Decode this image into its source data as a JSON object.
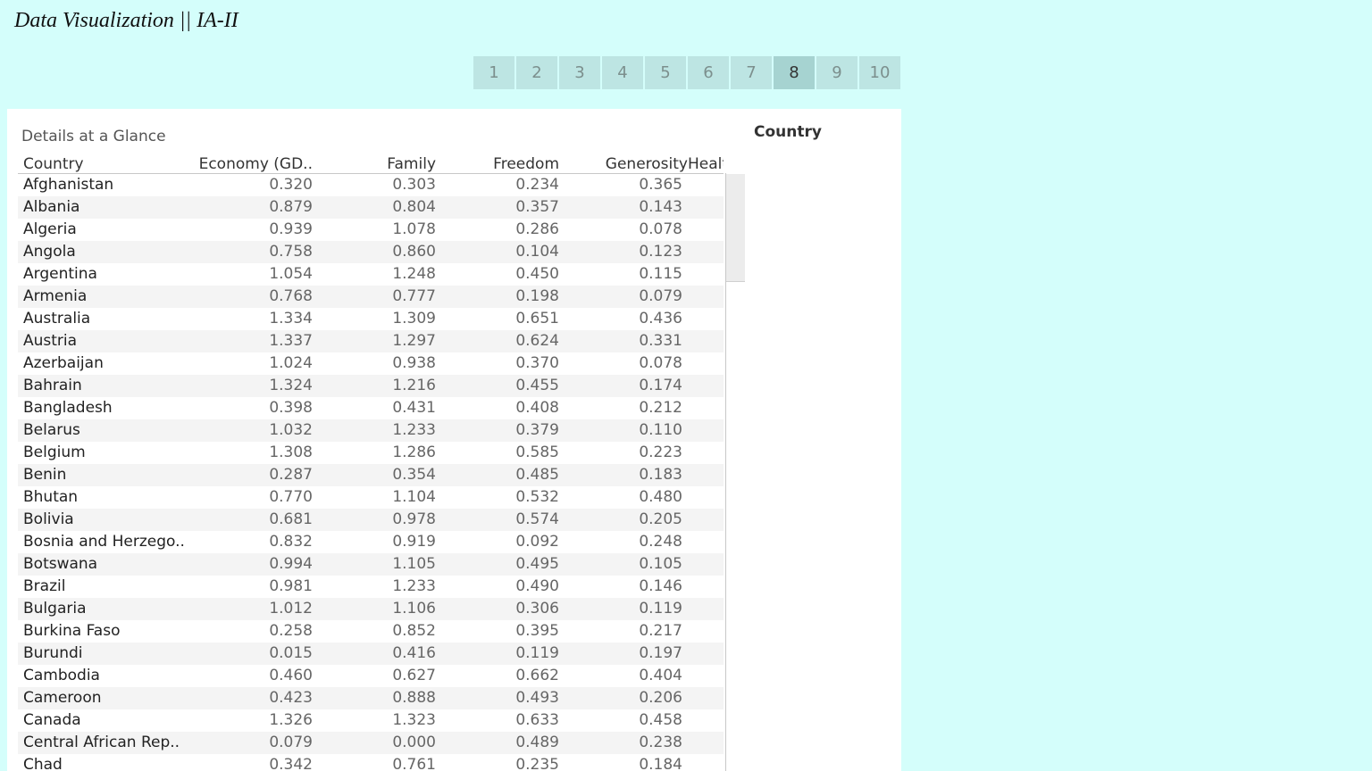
{
  "app": {
    "title": "Data Visualization || IA-II"
  },
  "tabs": [
    {
      "label": "1",
      "active": false
    },
    {
      "label": "2",
      "active": false
    },
    {
      "label": "3",
      "active": false
    },
    {
      "label": "4",
      "active": false
    },
    {
      "label": "5",
      "active": false
    },
    {
      "label": "6",
      "active": false
    },
    {
      "label": "7",
      "active": false
    },
    {
      "label": "8",
      "active": true
    },
    {
      "label": "9",
      "active": false
    },
    {
      "label": "10",
      "active": false
    }
  ],
  "sheet": {
    "title": "Details at a Glance"
  },
  "filter": {
    "title": "Country"
  },
  "table": {
    "headers": {
      "country": "Country",
      "economy": "Economy (GD..",
      "family": "Family",
      "freedom": "Freedom",
      "generosity": "Generosity",
      "health": "Healt"
    },
    "rows": [
      [
        "Afghanistan",
        "0.320",
        "0.303",
        "0.234",
        "0.365"
      ],
      [
        "Albania",
        "0.879",
        "0.804",
        "0.357",
        "0.143"
      ],
      [
        "Algeria",
        "0.939",
        "1.078",
        "0.286",
        "0.078"
      ],
      [
        "Angola",
        "0.758",
        "0.860",
        "0.104",
        "0.123"
      ],
      [
        "Argentina",
        "1.054",
        "1.248",
        "0.450",
        "0.115"
      ],
      [
        "Armenia",
        "0.768",
        "0.777",
        "0.198",
        "0.079"
      ],
      [
        "Australia",
        "1.334",
        "1.309",
        "0.651",
        "0.436"
      ],
      [
        "Austria",
        "1.337",
        "1.297",
        "0.624",
        "0.331"
      ],
      [
        "Azerbaijan",
        "1.024",
        "0.938",
        "0.370",
        "0.078"
      ],
      [
        "Bahrain",
        "1.324",
        "1.216",
        "0.455",
        "0.174"
      ],
      [
        "Bangladesh",
        "0.398",
        "0.431",
        "0.408",
        "0.212"
      ],
      [
        "Belarus",
        "1.032",
        "1.233",
        "0.379",
        "0.110"
      ],
      [
        "Belgium",
        "1.308",
        "1.286",
        "0.585",
        "0.223"
      ],
      [
        "Benin",
        "0.287",
        "0.354",
        "0.485",
        "0.183"
      ],
      [
        "Bhutan",
        "0.770",
        "1.104",
        "0.532",
        "0.480"
      ],
      [
        "Bolivia",
        "0.681",
        "0.978",
        "0.574",
        "0.205"
      ],
      [
        "Bosnia and Herzego..",
        "0.832",
        "0.919",
        "0.092",
        "0.248"
      ],
      [
        "Botswana",
        "0.994",
        "1.105",
        "0.495",
        "0.105"
      ],
      [
        "Brazil",
        "0.981",
        "1.233",
        "0.490",
        "0.146"
      ],
      [
        "Bulgaria",
        "1.012",
        "1.106",
        "0.306",
        "0.119"
      ],
      [
        "Burkina Faso",
        "0.258",
        "0.852",
        "0.395",
        "0.217"
      ],
      [
        "Burundi",
        "0.015",
        "0.416",
        "0.119",
        "0.197"
      ],
      [
        "Cambodia",
        "0.460",
        "0.627",
        "0.662",
        "0.404"
      ],
      [
        "Cameroon",
        "0.423",
        "0.888",
        "0.493",
        "0.206"
      ],
      [
        "Canada",
        "1.326",
        "1.323",
        "0.633",
        "0.458"
      ],
      [
        "Central African Rep..",
        "0.079",
        "0.000",
        "0.489",
        "0.238"
      ],
      [
        "Chad",
        "0.342",
        "0.761",
        "0.235",
        "0.184"
      ]
    ]
  }
}
